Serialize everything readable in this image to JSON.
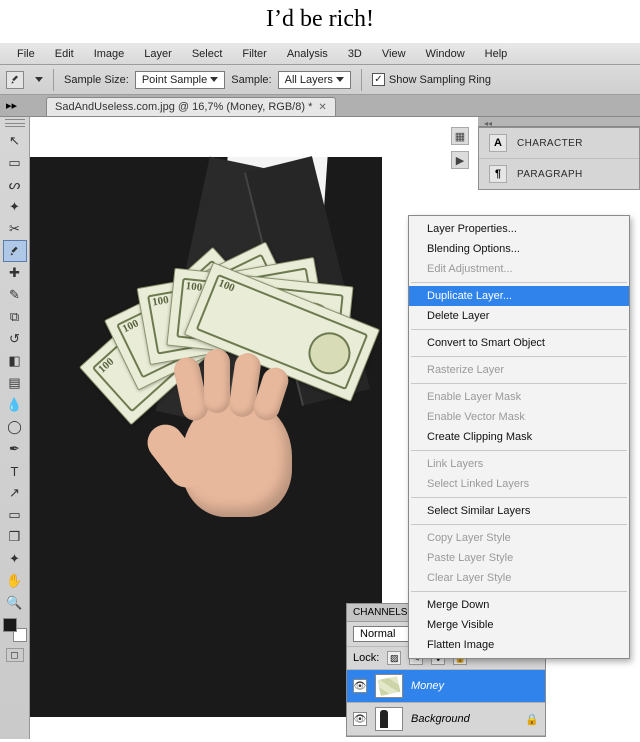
{
  "caption": "I’d be rich!",
  "menubar": {
    "items": [
      "File",
      "Edit",
      "Image",
      "Layer",
      "Select",
      "Filter",
      "Analysis",
      "3D",
      "View",
      "Window",
      "Help"
    ]
  },
  "options": {
    "sample_size_label": "Sample Size:",
    "sample_size_value": "Point Sample",
    "sample_label": "Sample:",
    "sample_value": "All Layers",
    "show_sampling_ring": "Show Sampling Ring",
    "show_sampling_ring_checked": true
  },
  "document_tab": {
    "title": "SadAndUseless.com.jpg @ 16,7% (Money, RGB/8) *"
  },
  "toolbox": [
    {
      "name": "move-tool",
      "glyph": "↖"
    },
    {
      "name": "marquee-tool",
      "glyph": "▭"
    },
    {
      "name": "lasso-tool",
      "glyph": "ᔕ"
    },
    {
      "name": "magic-wand-tool",
      "glyph": "✦"
    },
    {
      "name": "crop-tool",
      "glyph": "✂"
    },
    {
      "name": "eyedropper-tool",
      "glyph": "",
      "active": true
    },
    {
      "name": "spot-heal-tool",
      "glyph": "✚"
    },
    {
      "name": "brush-tool",
      "glyph": "✎"
    },
    {
      "name": "clone-stamp-tool",
      "glyph": "⧉"
    },
    {
      "name": "history-brush-tool",
      "glyph": "↺"
    },
    {
      "name": "eraser-tool",
      "glyph": "◧"
    },
    {
      "name": "gradient-tool",
      "glyph": "▤"
    },
    {
      "name": "blur-tool",
      "glyph": "💧"
    },
    {
      "name": "dodge-tool",
      "glyph": "◯"
    },
    {
      "name": "pen-tool",
      "glyph": "✒"
    },
    {
      "name": "type-tool",
      "glyph": "T"
    },
    {
      "name": "path-select-tool",
      "glyph": "↗"
    },
    {
      "name": "shape-tool",
      "glyph": "▭"
    },
    {
      "name": "3d-tool",
      "glyph": "❒"
    },
    {
      "name": "3d-camera-tool",
      "glyph": "✦"
    },
    {
      "name": "hand-tool",
      "glyph": "✋"
    },
    {
      "name": "zoom-tool",
      "glyph": "🔍"
    }
  ],
  "quickmask_label": "◻",
  "char_panel": {
    "character": "CHARACTER",
    "paragraph": "PARAGRAPH"
  },
  "layers_panel": {
    "header": "CHANNELS",
    "blend_mode": "Normal",
    "lock_label": "Lock:",
    "layers": [
      {
        "name": "Money",
        "active": true
      },
      {
        "name": "Background",
        "active": false,
        "locked": true
      }
    ]
  },
  "context_menu": {
    "items": [
      {
        "label": "Layer Properties...",
        "enabled": true
      },
      {
        "label": "Blending Options...",
        "enabled": true
      },
      {
        "label": "Edit Adjustment...",
        "enabled": false
      },
      {
        "sep": true
      },
      {
        "label": "Duplicate Layer...",
        "enabled": true,
        "highlight": true
      },
      {
        "label": "Delete Layer",
        "enabled": true
      },
      {
        "sep": true
      },
      {
        "label": "Convert to Smart Object",
        "enabled": true
      },
      {
        "sep": true
      },
      {
        "label": "Rasterize Layer",
        "enabled": false
      },
      {
        "sep": true
      },
      {
        "label": "Enable Layer Mask",
        "enabled": false
      },
      {
        "label": "Enable Vector Mask",
        "enabled": false
      },
      {
        "label": "Create Clipping Mask",
        "enabled": true
      },
      {
        "sep": true
      },
      {
        "label": "Link Layers",
        "enabled": false
      },
      {
        "label": "Select Linked Layers",
        "enabled": false
      },
      {
        "sep": true
      },
      {
        "label": "Select Similar Layers",
        "enabled": true
      },
      {
        "sep": true
      },
      {
        "label": "Copy Layer Style",
        "enabled": false
      },
      {
        "label": "Paste Layer Style",
        "enabled": false
      },
      {
        "label": "Clear Layer Style",
        "enabled": false
      },
      {
        "sep": true
      },
      {
        "label": "Merge Down",
        "enabled": true
      },
      {
        "label": "Merge Visible",
        "enabled": true
      },
      {
        "label": "Flatten Image",
        "enabled": true
      }
    ]
  }
}
